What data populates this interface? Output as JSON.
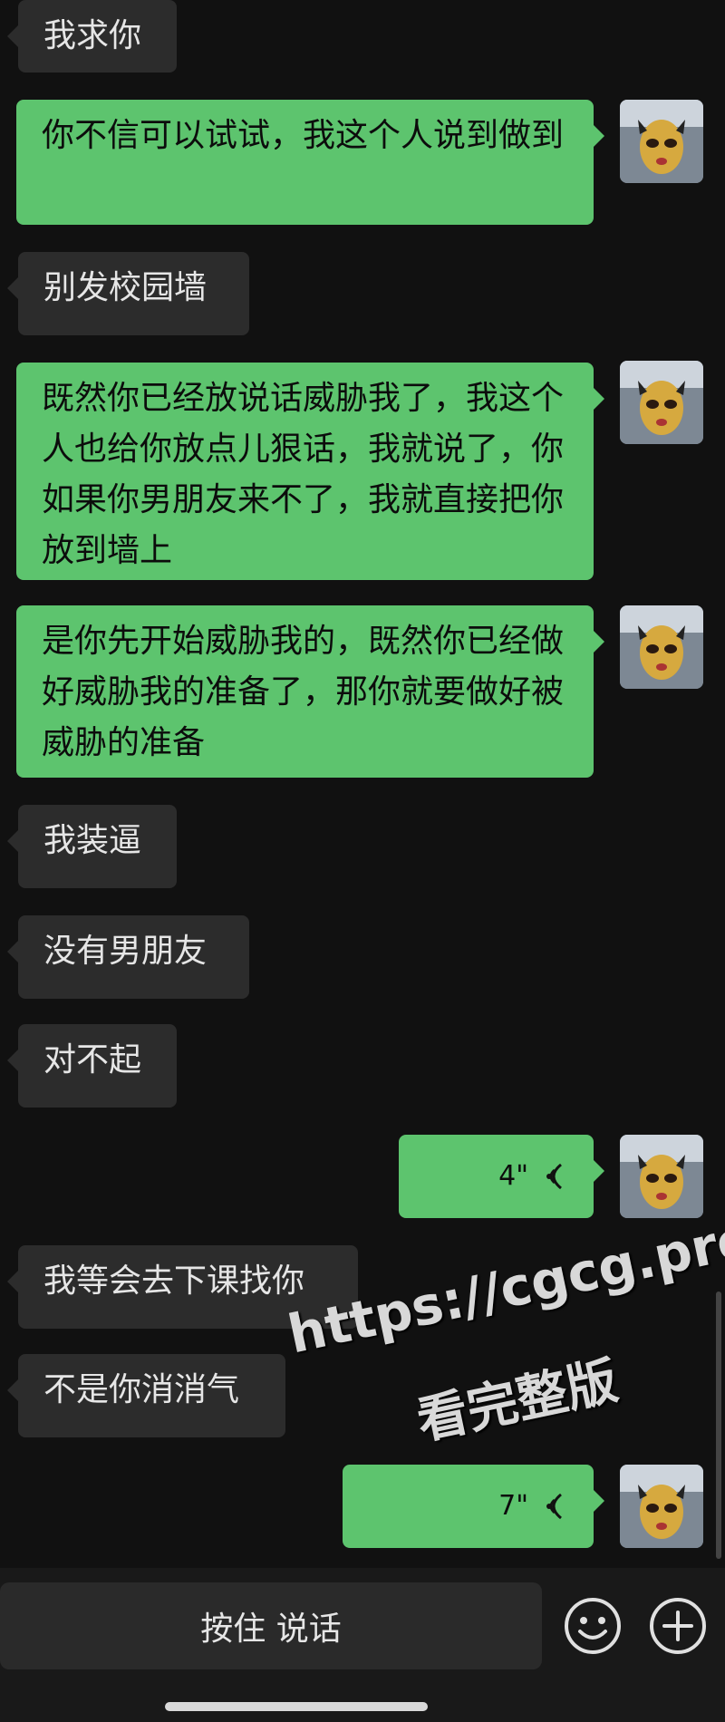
{
  "messages": [
    {
      "side": "in",
      "text": "我求你"
    },
    {
      "side": "out",
      "text": "你不信可以试试，我这个人说到做到"
    },
    {
      "side": "in",
      "text": "别发校园墙"
    },
    {
      "side": "out",
      "text": "既然你已经放说话威胁我了，我这个人也给你放点儿狠话，我就说了，你如果你男朋友来不了，我就直接把你放到墙上"
    },
    {
      "side": "out",
      "text": "是你先开始威胁我的，既然你已经做好威胁我的准备了，那你就要做好被威胁的准备"
    },
    {
      "side": "in",
      "text": "我装逼"
    },
    {
      "side": "in",
      "text": "没有男朋友"
    },
    {
      "side": "in",
      "text": "对不起"
    },
    {
      "side": "out",
      "voice_duration": "4\""
    },
    {
      "side": "in",
      "text": "我等会去下课找你"
    },
    {
      "side": "in",
      "text": "不是你消消气"
    },
    {
      "side": "out",
      "voice_duration": "7\""
    }
  ],
  "input_bar": {
    "hold_to_talk_label": "按住 说话",
    "emoji_icon": "emoji-icon",
    "add_icon": "plus-icon"
  },
  "watermark": {
    "line1": "https://cgcg.pro",
    "line2": "看完整版"
  },
  "colors": {
    "background": "#111111",
    "outgoing_bubble": "#5dc46e",
    "incoming_bubble": "#2c2c2c"
  }
}
